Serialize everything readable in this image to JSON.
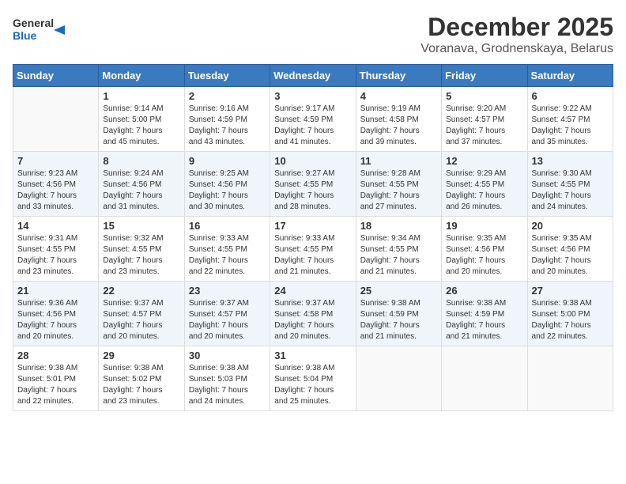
{
  "header": {
    "logo_general": "General",
    "logo_blue": "Blue",
    "month_title": "December 2025",
    "subtitle": "Voranava, Grodnenskaya, Belarus"
  },
  "days_of_week": [
    "Sunday",
    "Monday",
    "Tuesday",
    "Wednesday",
    "Thursday",
    "Friday",
    "Saturday"
  ],
  "weeks": [
    [
      {
        "day": "",
        "info": ""
      },
      {
        "day": "1",
        "info": "Sunrise: 9:14 AM\nSunset: 5:00 PM\nDaylight: 7 hours\nand 45 minutes."
      },
      {
        "day": "2",
        "info": "Sunrise: 9:16 AM\nSunset: 4:59 PM\nDaylight: 7 hours\nand 43 minutes."
      },
      {
        "day": "3",
        "info": "Sunrise: 9:17 AM\nSunset: 4:59 PM\nDaylight: 7 hours\nand 41 minutes."
      },
      {
        "day": "4",
        "info": "Sunrise: 9:19 AM\nSunset: 4:58 PM\nDaylight: 7 hours\nand 39 minutes."
      },
      {
        "day": "5",
        "info": "Sunrise: 9:20 AM\nSunset: 4:57 PM\nDaylight: 7 hours\nand 37 minutes."
      },
      {
        "day": "6",
        "info": "Sunrise: 9:22 AM\nSunset: 4:57 PM\nDaylight: 7 hours\nand 35 minutes."
      }
    ],
    [
      {
        "day": "7",
        "info": "Sunrise: 9:23 AM\nSunset: 4:56 PM\nDaylight: 7 hours\nand 33 minutes."
      },
      {
        "day": "8",
        "info": "Sunrise: 9:24 AM\nSunset: 4:56 PM\nDaylight: 7 hours\nand 31 minutes."
      },
      {
        "day": "9",
        "info": "Sunrise: 9:25 AM\nSunset: 4:56 PM\nDaylight: 7 hours\nand 30 minutes."
      },
      {
        "day": "10",
        "info": "Sunrise: 9:27 AM\nSunset: 4:55 PM\nDaylight: 7 hours\nand 28 minutes."
      },
      {
        "day": "11",
        "info": "Sunrise: 9:28 AM\nSunset: 4:55 PM\nDaylight: 7 hours\nand 27 minutes."
      },
      {
        "day": "12",
        "info": "Sunrise: 9:29 AM\nSunset: 4:55 PM\nDaylight: 7 hours\nand 26 minutes."
      },
      {
        "day": "13",
        "info": "Sunrise: 9:30 AM\nSunset: 4:55 PM\nDaylight: 7 hours\nand 24 minutes."
      }
    ],
    [
      {
        "day": "14",
        "info": "Sunrise: 9:31 AM\nSunset: 4:55 PM\nDaylight: 7 hours\nand 23 minutes."
      },
      {
        "day": "15",
        "info": "Sunrise: 9:32 AM\nSunset: 4:55 PM\nDaylight: 7 hours\nand 23 minutes."
      },
      {
        "day": "16",
        "info": "Sunrise: 9:33 AM\nSunset: 4:55 PM\nDaylight: 7 hours\nand 22 minutes."
      },
      {
        "day": "17",
        "info": "Sunrise: 9:33 AM\nSunset: 4:55 PM\nDaylight: 7 hours\nand 21 minutes."
      },
      {
        "day": "18",
        "info": "Sunrise: 9:34 AM\nSunset: 4:55 PM\nDaylight: 7 hours\nand 21 minutes."
      },
      {
        "day": "19",
        "info": "Sunrise: 9:35 AM\nSunset: 4:56 PM\nDaylight: 7 hours\nand 20 minutes."
      },
      {
        "day": "20",
        "info": "Sunrise: 9:35 AM\nSunset: 4:56 PM\nDaylight: 7 hours\nand 20 minutes."
      }
    ],
    [
      {
        "day": "21",
        "info": "Sunrise: 9:36 AM\nSunset: 4:56 PM\nDaylight: 7 hours\nand 20 minutes."
      },
      {
        "day": "22",
        "info": "Sunrise: 9:37 AM\nSunset: 4:57 PM\nDaylight: 7 hours\nand 20 minutes."
      },
      {
        "day": "23",
        "info": "Sunrise: 9:37 AM\nSunset: 4:57 PM\nDaylight: 7 hours\nand 20 minutes."
      },
      {
        "day": "24",
        "info": "Sunrise: 9:37 AM\nSunset: 4:58 PM\nDaylight: 7 hours\nand 20 minutes."
      },
      {
        "day": "25",
        "info": "Sunrise: 9:38 AM\nSunset: 4:59 PM\nDaylight: 7 hours\nand 21 minutes."
      },
      {
        "day": "26",
        "info": "Sunrise: 9:38 AM\nSunset: 4:59 PM\nDaylight: 7 hours\nand 21 minutes."
      },
      {
        "day": "27",
        "info": "Sunrise: 9:38 AM\nSunset: 5:00 PM\nDaylight: 7 hours\nand 22 minutes."
      }
    ],
    [
      {
        "day": "28",
        "info": "Sunrise: 9:38 AM\nSunset: 5:01 PM\nDaylight: 7 hours\nand 22 minutes."
      },
      {
        "day": "29",
        "info": "Sunrise: 9:38 AM\nSunset: 5:02 PM\nDaylight: 7 hours\nand 23 minutes."
      },
      {
        "day": "30",
        "info": "Sunrise: 9:38 AM\nSunset: 5:03 PM\nDaylight: 7 hours\nand 24 minutes."
      },
      {
        "day": "31",
        "info": "Sunrise: 9:38 AM\nSunset: 5:04 PM\nDaylight: 7 hours\nand 25 minutes."
      },
      {
        "day": "",
        "info": ""
      },
      {
        "day": "",
        "info": ""
      },
      {
        "day": "",
        "info": ""
      }
    ]
  ]
}
